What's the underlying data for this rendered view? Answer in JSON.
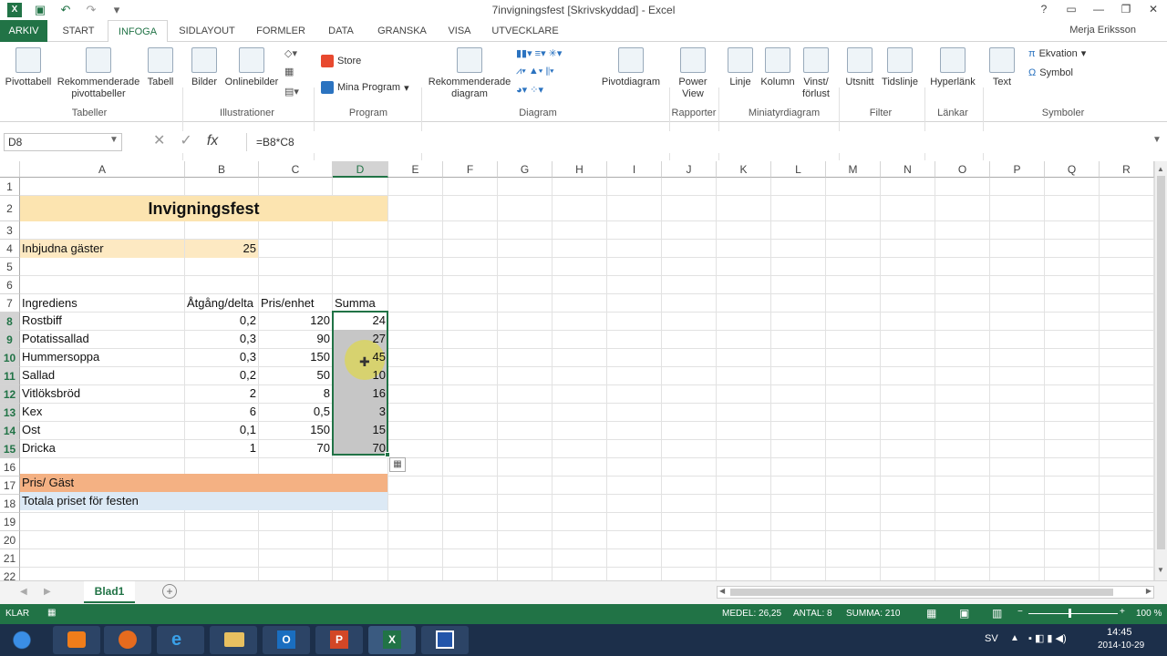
{
  "window": {
    "title": "7invigningsfest  [Skrivskyddad] - Excel",
    "controls": [
      "?",
      "▭",
      "—",
      "❐",
      "✕"
    ]
  },
  "tabs": [
    "ARKIV",
    "START",
    "INFOGA",
    "SIDLAYOUT",
    "FORMLER",
    "DATA",
    "GRANSKA",
    "VISA",
    "UTVECKLARE"
  ],
  "user": "Merja Eriksson",
  "ribbon": {
    "pivot": "Pivottabell",
    "recpivot": "Rekommenderade pivottabeller",
    "table": "Tabell",
    "images": "Bilder",
    "onlineimages": "Onlinebilder",
    "store": "Store",
    "myapps": "Mina Program",
    "recchart": "Rekommenderade diagram",
    "pivotchart": "Pivotdiagram",
    "powerview": "Power View",
    "line": "Linje",
    "column": "Kolumn",
    "winloss": "Vinst/ förlust",
    "slicer": "Utsnitt",
    "timeline": "Tidslinje",
    "hyperlink": "Hyperlänk",
    "text": "Text",
    "equation": "Ekvation",
    "symbol": "Symbol",
    "groups": {
      "tables": "Tabeller",
      "illustrations": "Illustrationer",
      "apps": "Program",
      "charts": "Diagram",
      "reports": "Rapporter",
      "sparklines": "Miniatyrdiagram",
      "filter": "Filter",
      "links": "Länkar",
      "symbols": "Symboler"
    }
  },
  "formula": {
    "namebox": "D8",
    "fx": "fx",
    "value": "=B8*C8"
  },
  "columns": [
    "A",
    "B",
    "C",
    "D",
    "E",
    "F",
    "G",
    "H",
    "I",
    "J",
    "K",
    "L",
    "M",
    "N",
    "O",
    "P",
    "Q",
    "R"
  ],
  "rows": [
    "1",
    "2",
    "3",
    "4",
    "5",
    "6",
    "7",
    "8",
    "9",
    "10",
    "11",
    "12",
    "13",
    "14",
    "15",
    "16",
    "17",
    "18",
    "19",
    "20",
    "21",
    "22"
  ],
  "sheet": {
    "title": "Invigningsfest",
    "guests_label": "Inbjudna gäster",
    "guests_value": "25",
    "headers": [
      "Ingrediens",
      "Åtgång/delta",
      "Pris/enhet",
      "Summa"
    ],
    "items": [
      [
        "Rostbiff",
        "0,2",
        "120",
        "24"
      ],
      [
        "Potatissallad",
        "0,3",
        "90",
        "27"
      ],
      [
        "Hummersoppa",
        "0,3",
        "150",
        "45"
      ],
      [
        "Sallad",
        "0,2",
        "50",
        "10"
      ],
      [
        "Vitlöksbröd",
        "2",
        "8",
        "16"
      ],
      [
        "Kex",
        "6",
        "0,5",
        "3"
      ],
      [
        "Ost",
        "0,1",
        "150",
        "15"
      ],
      [
        "Dricka",
        "1",
        "70",
        "70"
      ]
    ],
    "price_per_guest": "Pris/ Gäst",
    "total_price": "Totala priset för festen"
  },
  "sheettab": "Blad1",
  "status": {
    "mode": "KLAR",
    "avg": "MEDEL: 26,25",
    "count": "ANTAL: 8",
    "sum": "SUMMA: 210",
    "zoom": "100 %"
  },
  "taskbar": {
    "lang": "SV",
    "time": "14:45",
    "date": "2014-10-29"
  },
  "colors": {
    "accent": "#217346",
    "title_fill": "#fce4b0",
    "guests_fill": "#fde9c2",
    "orange_fill": "#f4b183",
    "blue_fill": "#dce9f5"
  }
}
